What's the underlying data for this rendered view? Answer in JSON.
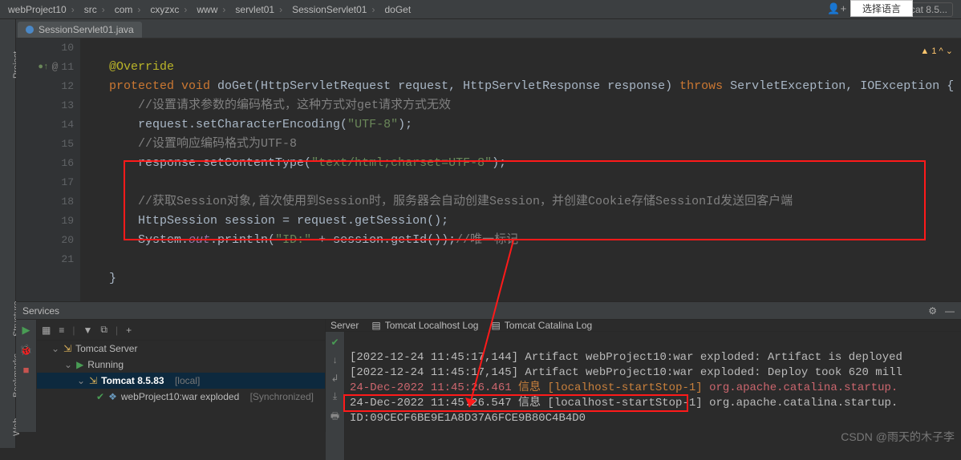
{
  "breadcrumb": [
    "webProject10",
    "src",
    "com",
    "cxyzxc",
    "www",
    "servlet01",
    "SessionServlet01",
    "doGet"
  ],
  "run_config": "Tomcat 8.5...",
  "file_tab": "SessionServlet01.java",
  "lang_button": "选择语言",
  "gutter_start": 10,
  "warn_badge": "1",
  "code": {
    "l10": "@Override",
    "l11_a": "protected void",
    "l11_b": " doGet(HttpServletRequest request, HttpServletResponse response) ",
    "l11_c": "throws",
    "l11_d": " ServletException, IOException {",
    "l12": "//设置请求参数的编码格式，这种方式对get请求方式无效",
    "l13_a": "request.setCharacterEncoding(",
    "l13_b": "\"UTF-8\"",
    "l13_c": ");",
    "l14": "//设置响应编码格式为UTF-8",
    "l15_a": "response.setContentType(",
    "l15_b": "\"text/html;charset=UTF-8\"",
    "l15_c": ");",
    "l17": "//获取Session对象,首次使用到Session时，服务器会自动创建Session，并创建Cookie存储SessionId发送回客户端",
    "l18": "HttpSession session = request.getSession();",
    "l19_a": "System.",
    "l19_b": "out",
    "l19_c": ".println(",
    "l19_d": "\"ID:\"",
    "l19_e": " + session.getId());",
    "l19_f": "//唯一标记",
    "l21": "}"
  },
  "svc_title": "Services",
  "svc_tree": {
    "root": "Tomcat Server",
    "running": "Running",
    "instance": "Tomcat 8.5.83",
    "instance_tag": "[local]",
    "artifact": "webProject10:war exploded",
    "artifact_tag": "[Synchronized]"
  },
  "console_tabs": {
    "server": "Server",
    "localhost": "Tomcat Localhost Log",
    "catalina": "Tomcat Catalina Log"
  },
  "console": {
    "l1": "[2022-12-24 11:45:17,144] Artifact webProject10:war exploded: Artifact is deployed",
    "l2": "[2022-12-24 11:45:17,145] Artifact webProject10:war exploded: Deploy took 620 mill",
    "l3_a": "24-Dec-2022 11:45:26.461 ",
    "l3_b": "信息 [localhost-startStop-1] ",
    "l3_c": "org.apache.catalina.startup.",
    "l4_a": "24-Dec-2022 11:45:26.547 信息 [localhost-startStop-1] org.apache.catalina.startup.",
    "l5": "ID:09CECF6BE9E1A8D37A6FCE9B80C4B4D0"
  },
  "watermark": "CSDN @雨天的木子李",
  "left_tabs": {
    "project": "Project",
    "structure": "Structure",
    "bookmarks": "Bookmarks",
    "web": "Web"
  }
}
